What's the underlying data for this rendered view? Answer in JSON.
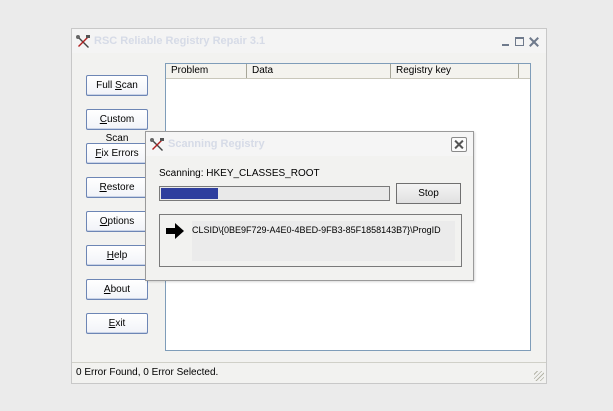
{
  "main_window": {
    "title": "RSC Reliable Registry Repair 3.1",
    "buttons": {
      "full_scan": {
        "pre": "Full ",
        "u": "S",
        "post": "can"
      },
      "custom_scan": {
        "pre": "",
        "u": "C",
        "post": "ustom Scan"
      },
      "fix_errors": {
        "pre": "",
        "u": "F",
        "post": "ix Errors"
      },
      "restore": {
        "pre": "",
        "u": "R",
        "post": "estore"
      },
      "options": {
        "pre": "",
        "u": "O",
        "post": "ptions"
      },
      "help": {
        "pre": "",
        "u": "H",
        "post": "elp"
      },
      "about": {
        "pre": "",
        "u": "A",
        "post": "bout"
      },
      "exit": {
        "pre": "",
        "u": "E",
        "post": "xit"
      }
    },
    "columns": [
      "Problem",
      "Data",
      "Registry key"
    ],
    "status": "0 Error Found,  0 Error Selected."
  },
  "dialog": {
    "title": "Scanning Registry",
    "scan_label": "Scanning: HKEY_CLASSES_ROOT",
    "progress": 0.25,
    "stop_label": "Stop",
    "current_key": "CLSID\\{0BE9F729-A4E0-4BED-9FB3-85F1858143B7}\\ProgID"
  },
  "icons": {
    "app": "tools-icon",
    "arrow": "right-arrow-icon"
  },
  "colors": {
    "progress_fill": "#2e3e9e",
    "button_border": "#6d86b5"
  }
}
